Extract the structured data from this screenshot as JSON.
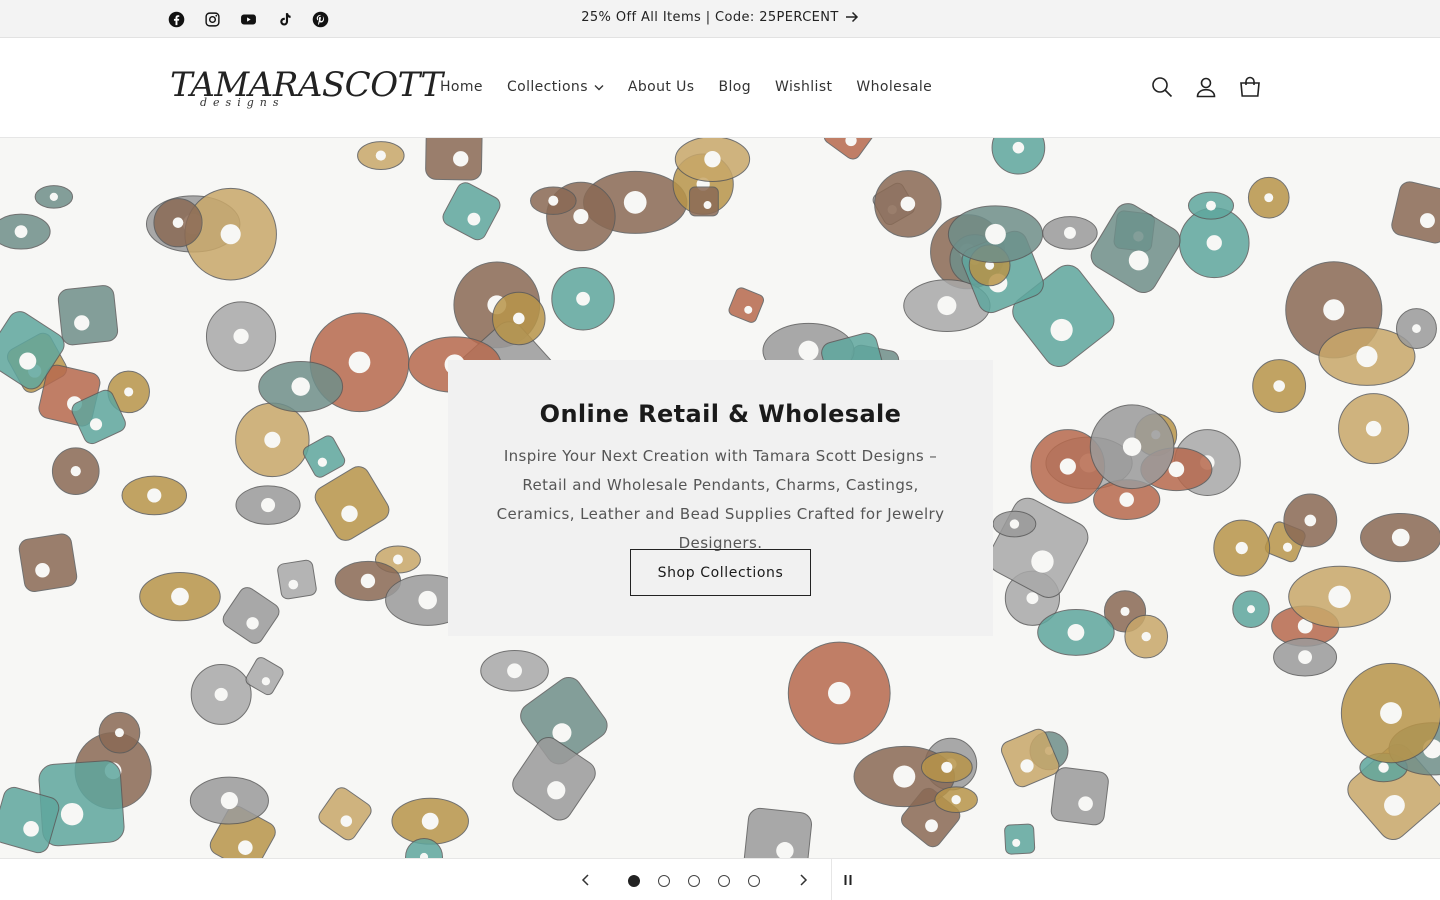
{
  "announcement": {
    "text": "25% Off All Items | Code: 25PERCENT",
    "social_icons": [
      "facebook-icon",
      "instagram-icon",
      "youtube-icon",
      "tiktok-icon",
      "pinterest-icon"
    ]
  },
  "header": {
    "logo_main": "TAMARASCOTT",
    "logo_sub": "designs",
    "nav": [
      {
        "label": "Home",
        "has_dropdown": false
      },
      {
        "label": "Collections",
        "has_dropdown": true
      },
      {
        "label": "About Us",
        "has_dropdown": false
      },
      {
        "label": "Blog",
        "has_dropdown": false
      },
      {
        "label": "Wishlist",
        "has_dropdown": false
      },
      {
        "label": "Wholesale",
        "has_dropdown": false
      }
    ],
    "icons": [
      "search-icon",
      "account-icon",
      "cart-icon"
    ]
  },
  "hero": {
    "title": "Online Retail & Wholesale",
    "text": "Inspire Your Next Creation with Tamara Scott Designs – Retail and Wholesale Pendants, Charms, Castings, Ceramics, Leather and Bead Supplies Crafted for Jewelry Designers.",
    "button_label": "Shop Collections"
  },
  "slider": {
    "slide_count": 5,
    "active_slide": 1
  },
  "colors": {
    "announcement_bg": "#f3f3f3",
    "card_bg": "#f1f1f1",
    "text": "#121212",
    "patina": "#5fa79e",
    "brass": "#b8954a",
    "silver": "#a9a9a9"
  }
}
